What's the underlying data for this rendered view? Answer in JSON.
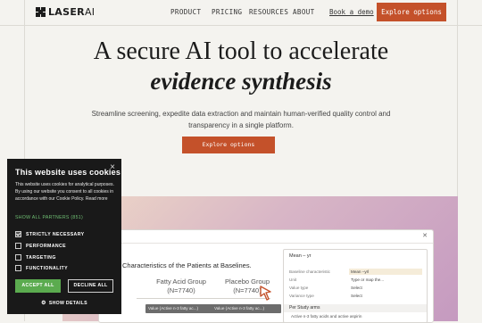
{
  "nav": {
    "logo_main": "LASER",
    "logo_ai": "AI",
    "links": [
      "PRODUCT",
      "PRICING",
      "RESOURCES",
      "ABOUT"
    ],
    "demo": "Book a demo",
    "cta": "Explore options"
  },
  "hero": {
    "line1": "A secure AI tool to accelerate",
    "line2": "evidence synthesis",
    "subtitle": "Streamline screening, expedite data extraction and maintain human-verified quality control and transparency in a single platform.",
    "cta": "Explore options"
  },
  "preview": {
    "table_title": "Characteristics of the Patients at Baselines.",
    "columns": [
      {
        "name": "Fatty Acid Group",
        "n": "(N=7740)"
      },
      {
        "name": "Placebo Group",
        "n": "(N=7740)"
      }
    ],
    "pills": [
      "Value (Active n-3 fatty ac...)",
      "Value (Active n-3 fatty ac...)"
    ],
    "panel": {
      "title": "Mean – yr",
      "rows": [
        {
          "label": "Baseline characteristic",
          "value": "Mean –yrl"
        },
        {
          "label": "Unit",
          "value": "Type or map the..."
        },
        {
          "label": "Value type",
          "value": "Select"
        },
        {
          "label": "Variance type",
          "value": "Select"
        }
      ],
      "section": "Per Study arms",
      "arm": "Active n-3 fatty acids and active aspirin"
    }
  },
  "cookie": {
    "title": "This website uses cookies",
    "close": "×",
    "body": "This website uses cookies for analytical purposes. By using our website you consent to all cookies in accordance with our Cookie Policy. Read more",
    "partners": "SHOW ALL PARTNERS (851)",
    "options": [
      {
        "label": "STRICTLY NECESSARY",
        "checked": true
      },
      {
        "label": "PERFORMANCE",
        "checked": false
      },
      {
        "label": "TARGETING",
        "checked": false
      },
      {
        "label": "FUNCTIONALITY",
        "checked": false
      }
    ],
    "accept": "ACCEPT ALL",
    "decline": "DECLINE ALL",
    "details": "SHOW DETAILS"
  },
  "colors": {
    "accent": "#c4512a",
    "accept": "#5bab4f",
    "banner": "#191919"
  }
}
